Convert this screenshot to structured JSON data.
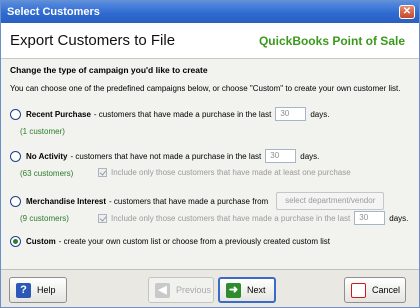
{
  "window": {
    "title": "Select Customers",
    "close_glyph": "✕"
  },
  "header": {
    "heading": "Export Customers to File",
    "brand": "QuickBooks Point of Sale"
  },
  "section": {
    "heading": "Change the type of campaign you'd like to create",
    "instructions": "You can choose one of the predefined campaigns below, or choose \"Custom\" to create your own customer list."
  },
  "options": {
    "recent_purchase": {
      "title": "Recent Purchase",
      "desc": "- customers that have made a purchase in the last",
      "days_value": "30",
      "suffix": "days.",
      "count": "(1 customer)",
      "selected": false
    },
    "no_activity": {
      "title": "No Activity",
      "desc": "- customers that have not made a purchase in the last",
      "days_value": "30",
      "suffix": "days.",
      "count": "(63 customers)",
      "checkbox_label": "Include only those customers that have made at least one purchase",
      "checkbox_checked": true,
      "selected": false
    },
    "merch_interest": {
      "title": "Merchandise Interest",
      "desc": "- customers that have made a purchase from",
      "button_label": "select department/vendor",
      "count": "(9 customers)",
      "checkbox_label": "Include only those customers that have made a purchase in the last",
      "checkbox_checked": true,
      "days_value": "30",
      "suffix": "days.",
      "selected": false
    },
    "custom": {
      "title": "Custom",
      "desc": "- create your own custom list or choose from a previously created custom list",
      "selected": true
    }
  },
  "footer": {
    "help_label": "Help",
    "previous_label": "Previous",
    "next_label": "Next",
    "cancel_label": "Cancel",
    "help_glyph": "?",
    "previous_glyph": "◀",
    "next_glyph": "➜",
    "cancel_glyph": "⊘"
  },
  "icons": [
    "close-icon",
    "help-icon",
    "previous-arrow-icon",
    "next-arrow-icon",
    "cancel-icon"
  ],
  "colors": {
    "titlebar": "#2f6bd1",
    "brand": "#3a9a1c",
    "count": "#2b7c2b"
  }
}
